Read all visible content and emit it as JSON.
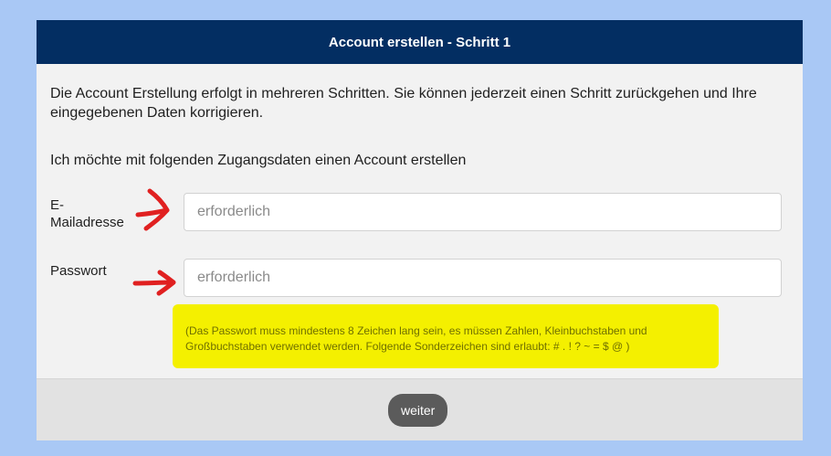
{
  "header": {
    "title": "Account erstellen - Schritt 1"
  },
  "main": {
    "intro": "Die Account Erstellung erfolgt in mehreren Schritten. Sie können jederzeit einen Schritt zurückgehen und Ihre eingegebenen Daten korrigieren.",
    "subtitle": "Ich möchte mit folgenden Zugangsdaten einen Account erstellen",
    "email": {
      "label_line1": "E-",
      "label_line2": "Mailadresse",
      "placeholder": "erforderlich",
      "value": ""
    },
    "password": {
      "label": "Passwort",
      "placeholder": "erforderlich",
      "value": ""
    },
    "password_hint": "(Das Passwort muss mindestens 8 Zeichen lang sein, es müssen Zahlen, Kleinbuchstaben und Großbuchstaben verwendet werden. Folgende Sonderzeichen sind erlaubt: # . ! ? ~ = $ @ )"
  },
  "footer": {
    "next_button_label": "weiter"
  },
  "colors": {
    "page_background": "#a9c8f5",
    "header_background": "#032e62",
    "card_background": "#f2f2f2",
    "hint_highlight": "#f4f000",
    "annotation_arrow": "#e02020",
    "button_background": "#5b5b5b"
  },
  "icons": [
    "annotation-arrow-icon"
  ]
}
